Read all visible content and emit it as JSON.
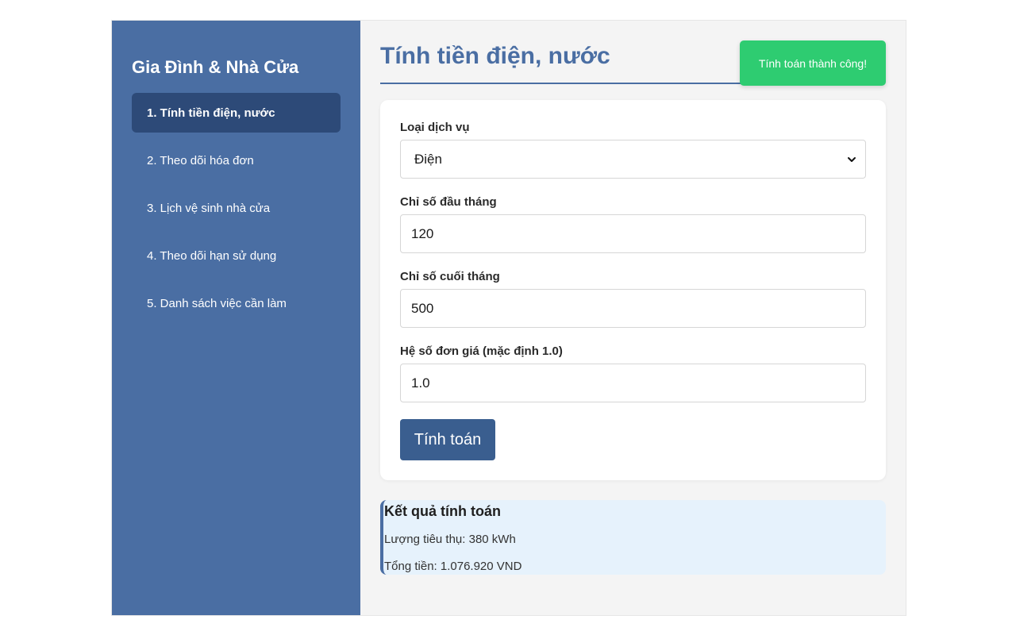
{
  "sidebar": {
    "title": "Gia Đình & Nhà Cửa",
    "items": [
      {
        "label": "1. Tính tiền điện, nước",
        "active": true
      },
      {
        "label": "2. Theo dõi hóa đơn",
        "active": false
      },
      {
        "label": "3. Lịch vệ sinh nhà cửa",
        "active": false
      },
      {
        "label": "4. Theo dõi hạn sử dụng",
        "active": false
      },
      {
        "label": "5. Danh sách việc cần làm",
        "active": false
      }
    ]
  },
  "main": {
    "title": "Tính tiền điện, nước",
    "toast": "Tính toán thành công!",
    "form": {
      "service_type_label": "Loại dịch vụ",
      "service_type_value": "Điện",
      "start_reading_label": "Chỉ số đầu tháng",
      "start_reading_value": "120",
      "end_reading_label": "Chỉ số cuối tháng",
      "end_reading_value": "500",
      "coefficient_label": "Hệ số đơn giá (mặc định 1.0)",
      "coefficient_value": "1.0",
      "submit_label": "Tính toán"
    },
    "result": {
      "title": "Kết quả tính toán",
      "consumption": "Lượng tiêu thụ: 380 kWh",
      "total": "Tổng tiền: 1.076.920 VND"
    }
  },
  "colors": {
    "sidebar_bg": "#4a6ea3",
    "sidebar_active": "#2d4a78",
    "accent": "#4a6ea3",
    "button": "#3a5e8f",
    "toast": "#2ecc71",
    "result_bg": "#e6f2fc"
  }
}
